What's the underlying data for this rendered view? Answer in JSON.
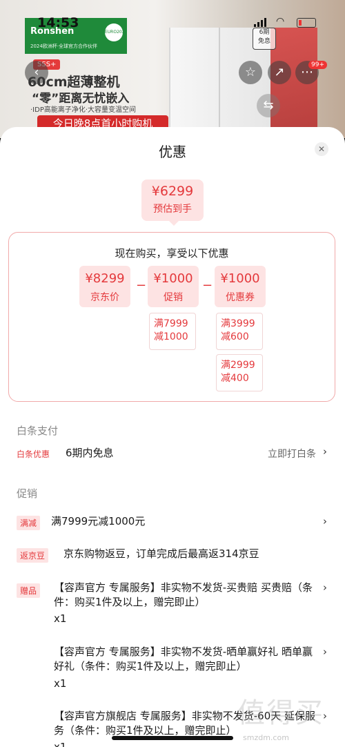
{
  "status_bar": {
    "time": "14:53"
  },
  "background": {
    "brand": "Ronshen",
    "euro_badge": "EURO2024",
    "banner_sub": "2024欧洲杯·全球官方合作伙伴",
    "tag_sss": "SSS+",
    "headline1": "60cm超薄整机",
    "headline2": "“零”距离无忧嵌入",
    "feature": "·IDP高能离子净化·大容量变温空间",
    "promo": "今日晚8点首小时购机",
    "badge_6": "6期\n免息",
    "cart_badge": "99+"
  },
  "sheet": {
    "title": "优惠",
    "estimate": {
      "price": "¥6299",
      "label": "预估到手"
    },
    "calc_title": "现在购买，享受以下优惠",
    "calc": [
      {
        "amount": "¥8299",
        "label": "京东价"
      },
      {
        "amount": "¥1000",
        "label": "促销"
      },
      {
        "amount": "¥1000",
        "label": "优惠券"
      }
    ],
    "operator": "−",
    "promo_cond": "满7999\n减1000",
    "coupon_conds": [
      "满3999\n减600",
      "满2999\n减400"
    ],
    "baitiao": {
      "header": "白条支付",
      "tag": "白条优惠",
      "text": "6期内免息",
      "link": "立即打白条"
    },
    "promotions": {
      "header": "促销",
      "items": [
        {
          "tag": "满减",
          "text": "满7999元减1000元",
          "qty": ""
        },
        {
          "tag": "返京豆",
          "text": "京东购物返豆，订单完成后最高返314京豆",
          "qty": ""
        },
        {
          "tag": "赠品",
          "text": "【容声官方 专属服务】非实物不发货-买贵赔 买贵赔（条件：购买1件及以上，赠完即止）",
          "qty": "x1"
        },
        {
          "tag": "",
          "text": "【容声官方 专属服务】非实物不发货-晒单赢好礼 晒单赢好礼（条件：购买1件及以上，赠完即止）",
          "qty": "x1"
        },
        {
          "tag": "",
          "text": "【容声官方旗舰店 专属服务】非实物不发货-60天 延保服务（条件：购买1件及以上，赠完即止）",
          "qty": "x1"
        }
      ]
    },
    "chevron": "›"
  },
  "watermark": {
    "main": "值得买",
    "sub": "smzdm.com"
  },
  "colors": {
    "accent": "#e4393c",
    "pill_bg": "#fde3e3"
  }
}
